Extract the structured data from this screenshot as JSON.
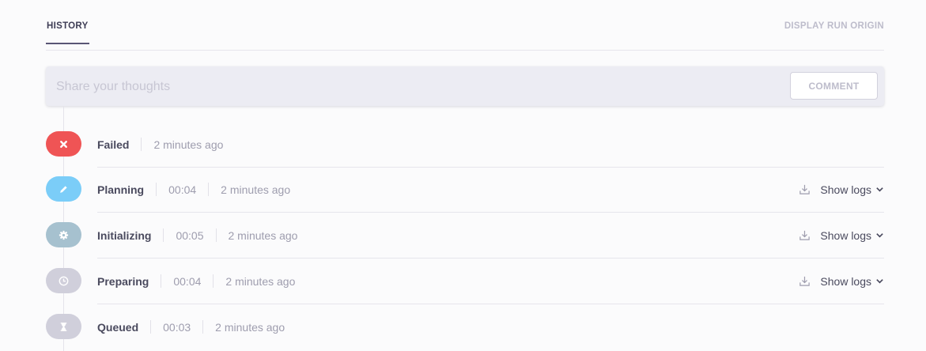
{
  "tabs": {
    "history": "HISTORY",
    "display_origin": "DISPLAY RUN ORIGIN"
  },
  "comment": {
    "placeholder": "Share your thoughts",
    "button": "COMMENT"
  },
  "history": [
    {
      "status": "Failed",
      "icon": "close-icon",
      "color": "#ef5455",
      "duration": "",
      "time": "2 minutes ago",
      "show_logs": ""
    },
    {
      "status": "Planning",
      "icon": "pencil-icon",
      "color": "#7bcdf8",
      "duration": "00:04",
      "time": "2 minutes ago",
      "show_logs": "Show logs"
    },
    {
      "status": "Initializing",
      "icon": "gear-icon",
      "color": "#a6c1cf",
      "duration": "00:05",
      "time": "2 minutes ago",
      "show_logs": "Show logs"
    },
    {
      "status": "Preparing",
      "icon": "clock-icon",
      "color": "#d0cfdb",
      "duration": "00:04",
      "time": "2 minutes ago",
      "show_logs": "Show logs"
    },
    {
      "status": "Queued",
      "icon": "hourglass-icon",
      "color": "#d0cfdb",
      "duration": "00:03",
      "time": "2 minutes ago",
      "show_logs": ""
    }
  ]
}
